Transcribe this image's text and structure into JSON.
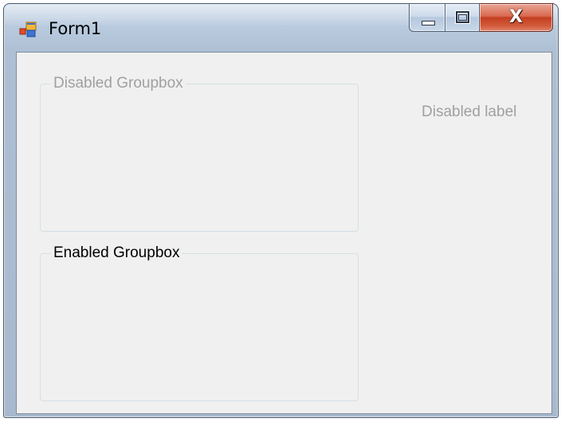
{
  "window": {
    "title": "Form1",
    "icon": "winforms-app-icon"
  },
  "caption_buttons": {
    "minimize": "minimize-icon",
    "maximize": "maximize-icon",
    "close_glyph": "X"
  },
  "client": {
    "disabled_groupbox": {
      "caption": "Disabled Groupbox",
      "enabled": false
    },
    "enabled_groupbox": {
      "caption": "Enabled Groupbox",
      "enabled": true
    },
    "disabled_label": {
      "text": "Disabled label",
      "enabled": false
    }
  },
  "colors": {
    "disabled_text": "#a0a0a0",
    "enabled_text": "#000000",
    "client_background": "#f0f0f0",
    "close_button": "#c43f21"
  }
}
